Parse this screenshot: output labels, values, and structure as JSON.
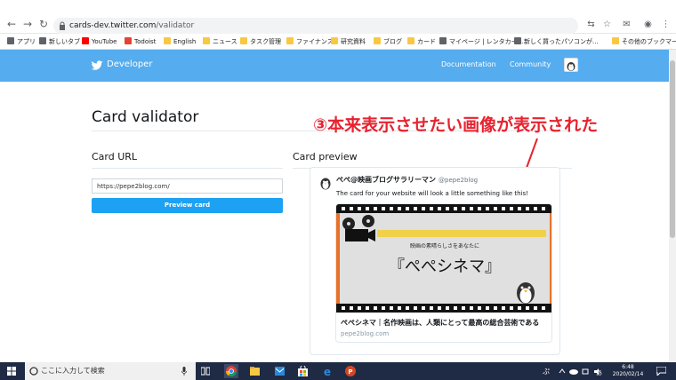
{
  "browser": {
    "url_host": "cards-dev.twitter.com",
    "url_path": "/validator",
    "bookmarks": [
      {
        "label": "アプリ",
        "color": "#5f6368"
      },
      {
        "label": "新しいタブ",
        "color": "#5f6368"
      },
      {
        "label": "YouTube",
        "color": "#ff0000"
      },
      {
        "label": "Todoist",
        "color": "#e44332"
      },
      {
        "label": "English",
        "color": "#f9c843"
      },
      {
        "label": "ニュース",
        "color": "#f9c843"
      },
      {
        "label": "タスク管理",
        "color": "#f9c843"
      },
      {
        "label": "ファイナンス",
        "color": "#f9c843"
      },
      {
        "label": "研究資料",
        "color": "#f9c843"
      },
      {
        "label": "ブログ",
        "color": "#f9c843"
      },
      {
        "label": "カード",
        "color": "#f9c843"
      },
      {
        "label": "マイページ | レンタカー...",
        "color": "#5f6368"
      },
      {
        "label": "新しく買ったパソコンが...",
        "color": "#5f6368"
      },
      {
        "label": "その他のブックマーク",
        "color": "#f9c843"
      }
    ]
  },
  "header": {
    "brand": "Developer",
    "nav": [
      "Documentation",
      "Community"
    ],
    "accent": "#55acee"
  },
  "main": {
    "title": "Card validator",
    "card_url_label": "Card URL",
    "url_value": "https://pepe2blog.com/",
    "preview_button": "Preview card",
    "card_preview_label": "Card preview"
  },
  "annotation": {
    "text": "③本来表示させたい画像が表示された",
    "color": "#e8222f"
  },
  "tweet": {
    "name": "ぺぺ@映画ブログサラリーマン",
    "handle": "@pepe2blog",
    "text": "The card for your website will look a little something like this!",
    "card": {
      "image_subtitle": "映画の素晴らしさをあなたに",
      "image_title": "『ぺぺシネマ』",
      "title": "ぺぺシネマ｜名作映画は、人類にとって最高の総合芸術である",
      "domain": "pepe2blog.com"
    }
  },
  "taskbar": {
    "search_placeholder": "ここに入力して検索",
    "ime": "ぷ",
    "time": "6:48",
    "date": "2020/02/14"
  }
}
